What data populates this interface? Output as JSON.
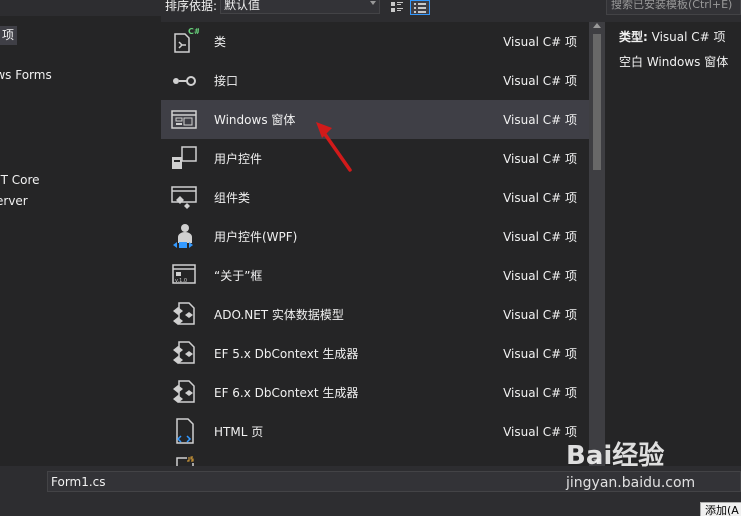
{
  "toolbar": {
    "sort_label": "排序依据:",
    "sort_value": "默认值",
    "search_placeholder": "搜索已安装模板(Ctrl+E)"
  },
  "left_panel": {
    "items": [
      {
        "label": "项"
      },
      {
        "label": "ows Forms"
      },
      {
        "label": "ET Core"
      },
      {
        "label": "erver"
      }
    ]
  },
  "templates": [
    {
      "name": "类",
      "type": "Visual C# 项",
      "icon": "csharp-class-icon"
    },
    {
      "name": "接口",
      "type": "Visual C# 项",
      "icon": "interface-icon"
    },
    {
      "name": "Windows 窗体",
      "type": "Visual C# 项",
      "icon": "windows-form-icon",
      "selected": true
    },
    {
      "name": "用户控件",
      "type": "Visual C# 项",
      "icon": "user-control-icon"
    },
    {
      "name": "组件类",
      "type": "Visual C# 项",
      "icon": "component-class-icon"
    },
    {
      "name": "用户控件(WPF)",
      "type": "Visual C# 项",
      "icon": "wpf-user-control-icon"
    },
    {
      "name": "“关于”框",
      "type": "Visual C# 项",
      "icon": "about-box-icon"
    },
    {
      "name": "ADO.NET 实体数据模型",
      "type": "Visual C# 项",
      "icon": "entity-model-icon"
    },
    {
      "name": "EF 5.x DbContext 生成器",
      "type": "Visual C# 项",
      "icon": "dbcontext-generator-icon"
    },
    {
      "name": "EF 6.x DbContext 生成器",
      "type": "Visual C# 项",
      "icon": "dbcontext-generator-icon"
    },
    {
      "name": "HTML 页",
      "type": "Visual C# 项",
      "icon": "html-page-icon"
    }
  ],
  "details": {
    "type_label": "类型:",
    "type_value": "Visual C# 项",
    "description": "空白 Windows 窗体"
  },
  "bottom": {
    "name_value": "Form1.cs",
    "add_label": "添加(A"
  },
  "watermark": {
    "logo": "Bai经验",
    "url": "jingyan.baidu.com"
  },
  "colors": {
    "accent": "#3399ff",
    "arrow": "#d11a1a",
    "selection": "#3f3f46"
  }
}
